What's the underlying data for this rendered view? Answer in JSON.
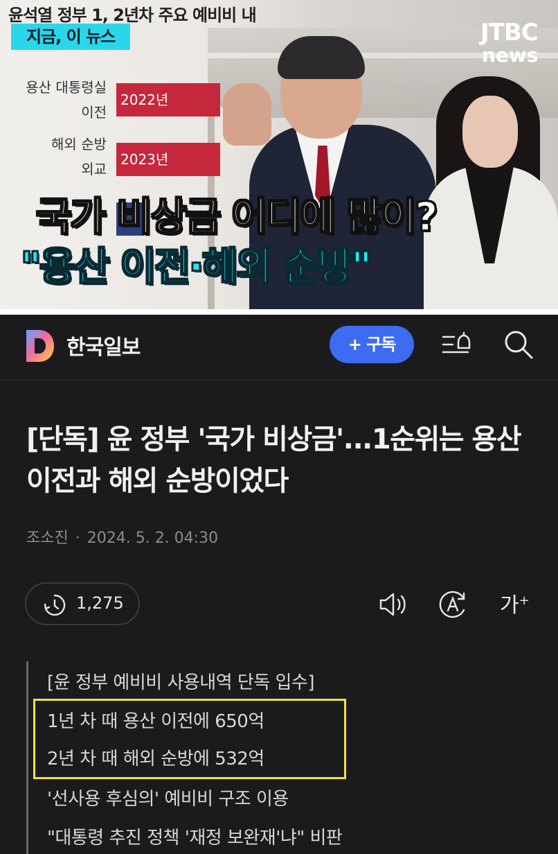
{
  "still": {
    "top_title": "윤석열 정부 1, 2년차 주요 예비비 내",
    "chip": "지금, 이 뉴스",
    "chart_categories": [
      "용산 대통령실",
      "이전",
      "해외 순방",
      "외교"
    ],
    "bar_labels": [
      "2022년",
      "2023년"
    ],
    "caption_line1": "국가 비상금 어디에 많이?",
    "caption_line2": "\"용산 이전·해외 순방\"",
    "broadcaster_top": "JTBC",
    "broadcaster_bottom": "news",
    "colors": {
      "chip": "#2ad7ea",
      "bar_red": "#c5283d",
      "bar_blue": "#2e3e7c",
      "caption_cyan": "#2ae2ef"
    }
  },
  "header": {
    "brand": "한국일보",
    "subscribe_label": "+ 구독",
    "icons": [
      "notification-menu-icon",
      "search-icon"
    ],
    "colors": {
      "subscribe": "#3d6cf0"
    }
  },
  "article": {
    "headline": "[단독] 윤 정부 '국가 비상금'...1순위는 용산 이전과 해외 순방이었다",
    "author": "조소진",
    "separator": "·",
    "date": "2024. 5. 2. 04:30",
    "views": "1,275",
    "font_size_label": "가",
    "font_size_plus": "+",
    "summary": [
      "[윤 정부 예비비 사용내역 단독 입수]",
      "1년 차 때 용산 이전에 650억",
      "2년 차 때 해외 순방에 532억",
      "'선사용 후심의' 예비비 구조 이용",
      "\"대통령 추진 정책 '재정 보완재'냐\" 비판"
    ],
    "highlight_color": "#f3e33a"
  }
}
